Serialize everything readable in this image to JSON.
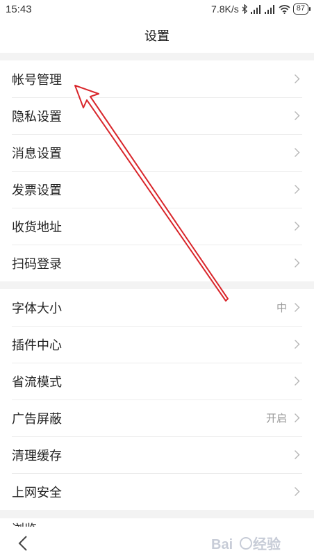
{
  "status": {
    "time": "15:43",
    "speed": "7.8K/s",
    "battery": "87"
  },
  "header": {
    "title": "设置"
  },
  "groups": [
    {
      "items": [
        {
          "label": "帐号管理"
        },
        {
          "label": "隐私设置"
        },
        {
          "label": "消息设置"
        },
        {
          "label": "发票设置"
        },
        {
          "label": "收货地址"
        },
        {
          "label": "扫码登录"
        }
      ]
    },
    {
      "items": [
        {
          "label": "字体大小",
          "value": "中"
        },
        {
          "label": "插件中心"
        },
        {
          "label": "省流模式"
        },
        {
          "label": "广告屏蔽",
          "value": "开启"
        },
        {
          "label": "清理缓存"
        },
        {
          "label": "上网安全"
        }
      ]
    }
  ],
  "peek": {
    "label": "浏览"
  },
  "colors": {
    "annotation_arrow": "#d9262b",
    "divider": "#ececec",
    "section_bg": "#f3f3f3"
  },
  "icons": {
    "back": "chevron-left-icon",
    "row_arrow": "chevron-right-icon"
  },
  "watermark": {
    "text": "Bai du 经验"
  }
}
